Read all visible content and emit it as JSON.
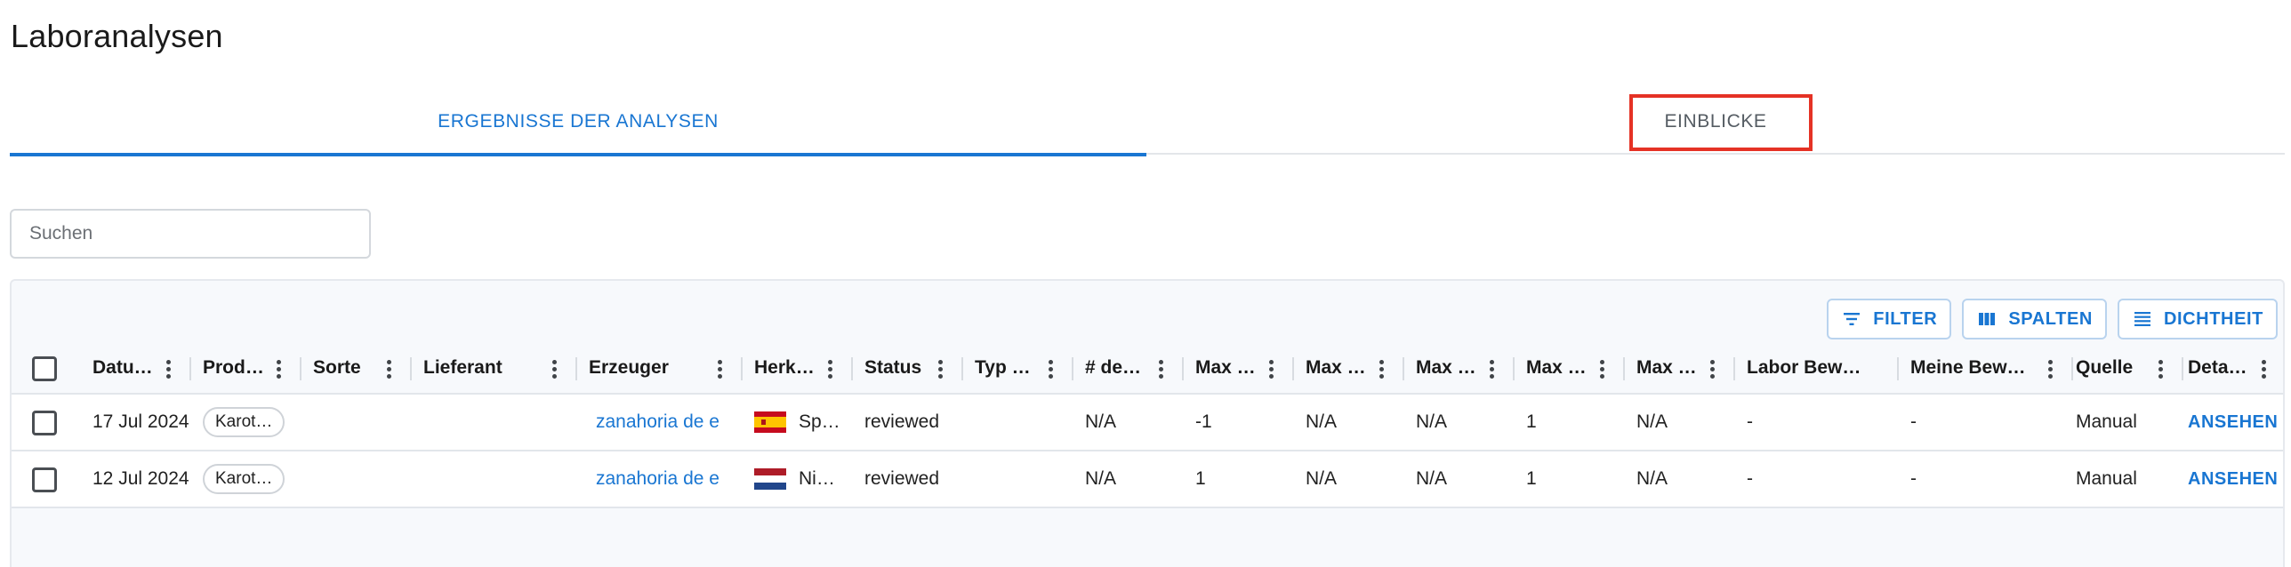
{
  "page": {
    "title": "Laboranalysen"
  },
  "tabs": [
    {
      "label": "ERGEBNISSE DER ANALYSEN",
      "active": true
    },
    {
      "label": "EINBLICKE",
      "active": false
    }
  ],
  "search": {
    "placeholder": "Suchen",
    "value": ""
  },
  "toolbar": {
    "filter_label": "FILTER",
    "columns_label": "SPALTEN",
    "density_label": "DICHTHEIT"
  },
  "columns": [
    "Datu…",
    "Prod…",
    "Sorte",
    "Lieferant",
    "Erzeuger",
    "Herk…",
    "Status",
    "Typ …",
    "# de…",
    "Max …",
    "Max …",
    "Max …",
    "Max …",
    "Max …",
    "Labor Bew…",
    "Meine Bew…",
    "Quelle",
    "Deta…"
  ],
  "rows": [
    {
      "date": "17 Jul 2024",
      "product": "Karot…",
      "sorte": "",
      "lieferant": "",
      "erzeuger": "zanahoria de e",
      "country_flag": "spain-flag",
      "herkunft": "Sp…",
      "status": "reviewed",
      "typ": "",
      "count": "N/A",
      "max1": "-1",
      "max2": "N/A",
      "max3": "N/A",
      "max4": "1",
      "max5": "N/A",
      "labor_bew": "-",
      "meine_bew": "-",
      "quelle": "Manual",
      "action": "ANSEHEN"
    },
    {
      "date": "12 Jul 2024",
      "product": "Karot…",
      "sorte": "",
      "lieferant": "",
      "erzeuger": "zanahoria de e",
      "country_flag": "netherlands-flag",
      "herkunft": "Ni…",
      "status": "reviewed",
      "typ": "",
      "count": "N/A",
      "max1": "1",
      "max2": "N/A",
      "max3": "N/A",
      "max4": "1",
      "max5": "N/A",
      "labor_bew": "-",
      "meine_bew": "-",
      "quelle": "Manual",
      "action": "ANSEHEN"
    }
  ],
  "colors": {
    "accent": "#1976d2",
    "highlight": "#e53225",
    "border": "#e2e6eb",
    "grid_bg": "#f7f9fc"
  }
}
